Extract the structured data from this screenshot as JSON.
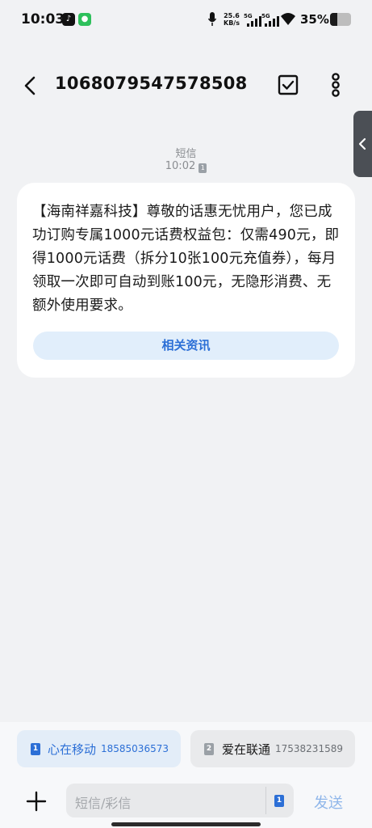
{
  "status_bar": {
    "time": "10:03",
    "net_speed": "25.6",
    "net_unit": "KB/s",
    "sim1_type": "5G",
    "sim2_type": "5G",
    "battery_percent": "35%",
    "battery_level": 0.35
  },
  "header": {
    "title": "1068079547578508"
  },
  "message": {
    "type_label": "短信",
    "time": "10:02",
    "sim_slot": "1",
    "body": "【海南祥嘉科技】尊敬的话惠无忧用户，您已成功订购专属1000元话费权益包：仅需490元，即得1000元话费（拆分10张100元充值券），每月领取一次即可自动到账100元，无隐形消费、无额外使用要求。",
    "related_button": "相关资讯"
  },
  "sim_cards": [
    {
      "slot": "1",
      "name": "心在移动",
      "number": "18585036573"
    },
    {
      "slot": "2",
      "name": "爱在联通",
      "number": "17538231589"
    }
  ],
  "composer": {
    "placeholder": "短信/彩信",
    "sim_slot": "1",
    "send_label": "发送"
  },
  "colors": {
    "accent": "#2c6fd6",
    "background": "#f1f2f4",
    "bubble": "#ffffff"
  }
}
